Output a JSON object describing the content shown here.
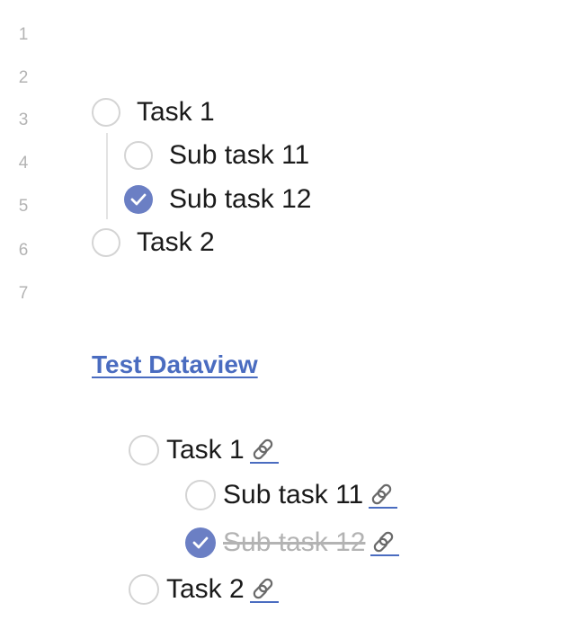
{
  "editor": {
    "line_numbers": [
      "1",
      "2",
      "3",
      "4",
      "5",
      "6",
      "7"
    ],
    "tasks": [
      {
        "label": "Task 1",
        "checked": false
      },
      {
        "label": "Sub task 11",
        "checked": false
      },
      {
        "label": "Sub task 12",
        "checked": true
      },
      {
        "label": "Task 2",
        "checked": false
      }
    ]
  },
  "dataview": {
    "heading": "Test Dataview",
    "tasks": [
      {
        "label": "Task 1",
        "checked": false,
        "icon": "link-icon"
      },
      {
        "label": "Sub task 11",
        "checked": false,
        "icon": "link-icon"
      },
      {
        "label": "Sub task 12",
        "checked": true,
        "icon": "link-icon"
      },
      {
        "label": "Task 2",
        "checked": false,
        "icon": "link-icon"
      }
    ]
  },
  "colors": {
    "accent": "#6b7fc4",
    "link": "#4a6cc0",
    "line_number": "#b3b3b3"
  }
}
